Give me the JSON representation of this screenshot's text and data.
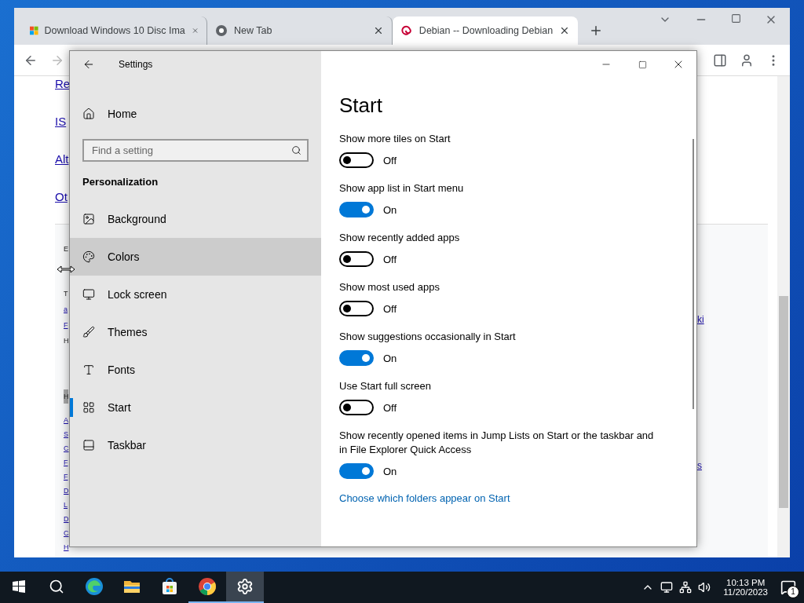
{
  "browser": {
    "tabs": [
      {
        "title": "Download Windows 10 Disc Ima",
        "selected": false
      },
      {
        "title": "New Tab",
        "selected": false
      },
      {
        "title": "Debian -- Downloading Debian",
        "selected": true
      }
    ]
  },
  "page": {
    "links": [
      "Re",
      "IS",
      "Alt",
      "Ot"
    ],
    "fragment_groups": [
      [
        {
          "text": "E",
          "kind": "text"
        }
      ],
      [
        {
          "text": "T",
          "kind": "text"
        },
        {
          "text": "a",
          "kind": "link"
        },
        {
          "text": "F",
          "kind": "link"
        },
        {
          "text": "H",
          "kind": "text"
        }
      ],
      [
        {
          "text": "H",
          "kind": "heading"
        }
      ],
      [
        {
          "text": "A",
          "kind": "link"
        },
        {
          "text": "S",
          "kind": "link"
        },
        {
          "text": "C",
          "kind": "link"
        },
        {
          "text": "F",
          "kind": "link"
        },
        {
          "text": "F",
          "kind": "link"
        },
        {
          "text": "D",
          "kind": "link"
        },
        {
          "text": "L",
          "kind": "link"
        },
        {
          "text": "D",
          "kind": "link"
        },
        {
          "text": "C",
          "kind": "link"
        },
        {
          "text": "H",
          "kind": "link"
        }
      ]
    ],
    "right_fragments": [
      "ki",
      "s"
    ]
  },
  "settings": {
    "title": "Settings",
    "home": "Home",
    "search": {
      "placeholder": "Find a setting"
    },
    "section": "Personalization",
    "nav": [
      {
        "label": "Background",
        "kind": "picture",
        "selected": false,
        "hovered": false
      },
      {
        "label": "Colors",
        "kind": "palette",
        "selected": false,
        "hovered": true
      },
      {
        "label": "Lock screen",
        "kind": "monitor",
        "selected": false,
        "hovered": false
      },
      {
        "label": "Themes",
        "kind": "brush",
        "selected": false,
        "hovered": false
      },
      {
        "label": "Fonts",
        "kind": "fonts",
        "selected": false,
        "hovered": false
      },
      {
        "label": "Start",
        "kind": "start",
        "selected": true,
        "hovered": false
      },
      {
        "label": "Taskbar",
        "kind": "taskbar",
        "selected": false,
        "hovered": false
      }
    ],
    "heading": "Start",
    "options": [
      {
        "label": "Show more tiles on Start",
        "on": false,
        "state_text": "Off"
      },
      {
        "label": "Show app list in Start menu",
        "on": true,
        "state_text": "On"
      },
      {
        "label": "Show recently added apps",
        "on": false,
        "state_text": "Off"
      },
      {
        "label": "Show most used apps",
        "on": false,
        "state_text": "Off"
      },
      {
        "label": "Show suggestions occasionally in Start",
        "on": true,
        "state_text": "On"
      },
      {
        "label": "Use Start full screen",
        "on": false,
        "state_text": "Off"
      },
      {
        "label": "Show recently opened items in Jump Lists on Start or the taskbar and in File Explorer Quick Access",
        "on": true,
        "state_text": "On"
      }
    ],
    "link": "Choose which folders appear on Start"
  },
  "taskbar": {
    "apps": [
      {
        "kind": "edge",
        "running": false,
        "active": false
      },
      {
        "kind": "folder",
        "running": false,
        "active": false
      },
      {
        "kind": "store",
        "running": false,
        "active": false
      },
      {
        "kind": "chrome",
        "running": true,
        "active": false
      },
      {
        "kind": "settings",
        "running": true,
        "active": true
      }
    ],
    "time": "10:13 PM",
    "date": "11/20/2023",
    "notifications": "1"
  }
}
